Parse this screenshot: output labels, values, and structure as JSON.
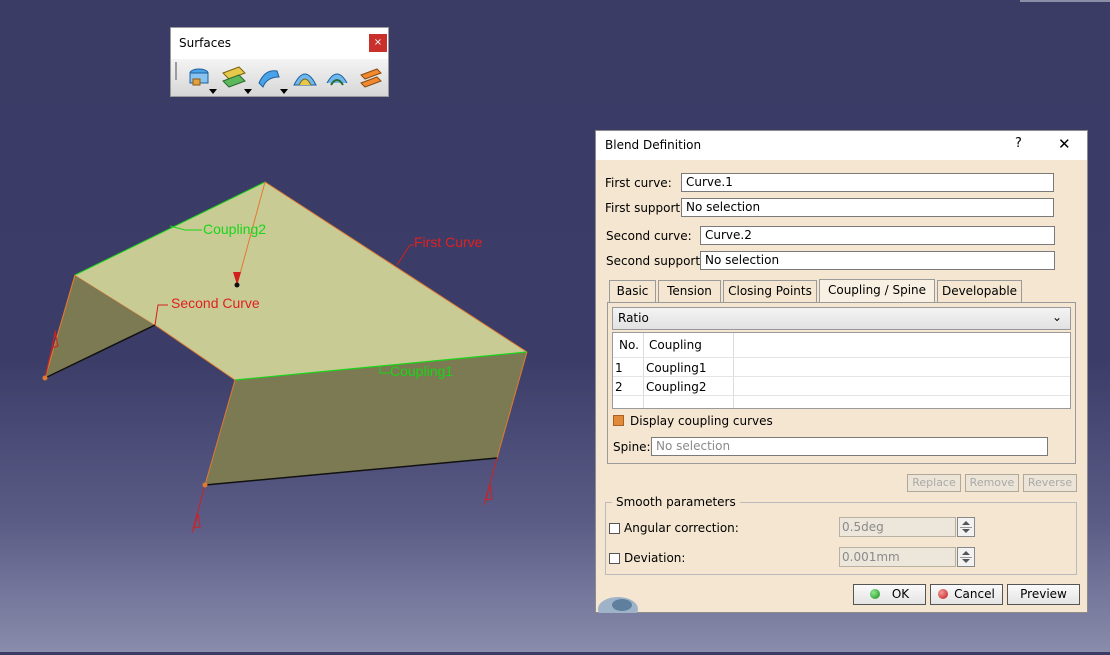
{
  "viewport": {
    "labels": {
      "first_curve": "First Curve",
      "second_curve": "Second Curve",
      "coupling1": "Coupling1",
      "coupling2": "Coupling2"
    },
    "colors": {
      "surface": "#c8cc94",
      "side_faces": "#7c7a52",
      "curve_label": "#e02020",
      "coupling_label": "#19d419"
    }
  },
  "surfaces_toolbar": {
    "title": "Surfaces",
    "close_label": "×",
    "icons": [
      "extrude-surface-icon",
      "offset-surface-icon",
      "sweep-surface-icon",
      "fill-surface-icon",
      "multi-section-surface-icon",
      "blend-surface-icon"
    ]
  },
  "dialog": {
    "title": "Blend Definition",
    "help_label": "?",
    "close_label": "✕",
    "first_curve_label": "First curve:",
    "first_curve_value": "Curve.1",
    "first_support_label": "First support:",
    "first_support_value": "No selection",
    "second_curve_label": "Second curve:",
    "second_curve_value": "Curve.2",
    "second_support_label": "Second support:",
    "second_support_value": "No selection",
    "tabs": [
      "Basic",
      "Tension",
      "Closing Points",
      "Coupling / Spine",
      "Developable"
    ],
    "active_tab": "Coupling / Spine",
    "coupling_mode": "Ratio",
    "table": {
      "headers": [
        "No.",
        "Coupling"
      ],
      "rows": [
        {
          "no": "1",
          "coupling": "Coupling1"
        },
        {
          "no": "2",
          "coupling": "Coupling2"
        }
      ]
    },
    "display_coupling_label": "Display coupling curves",
    "display_coupling_checked": true,
    "spine_label": "Spine:",
    "spine_placeholder": "No selection",
    "replace_label": "Replace",
    "remove_label": "Remove",
    "reverse_label": "Reverse",
    "smooth_title": "Smooth parameters",
    "angular_label": "Angular correction:",
    "angular_value": "0.5deg",
    "deviation_label": "Deviation:",
    "deviation_value": "0.001mm",
    "ok_label": "OK",
    "cancel_label": "Cancel",
    "preview_label": "Preview"
  }
}
